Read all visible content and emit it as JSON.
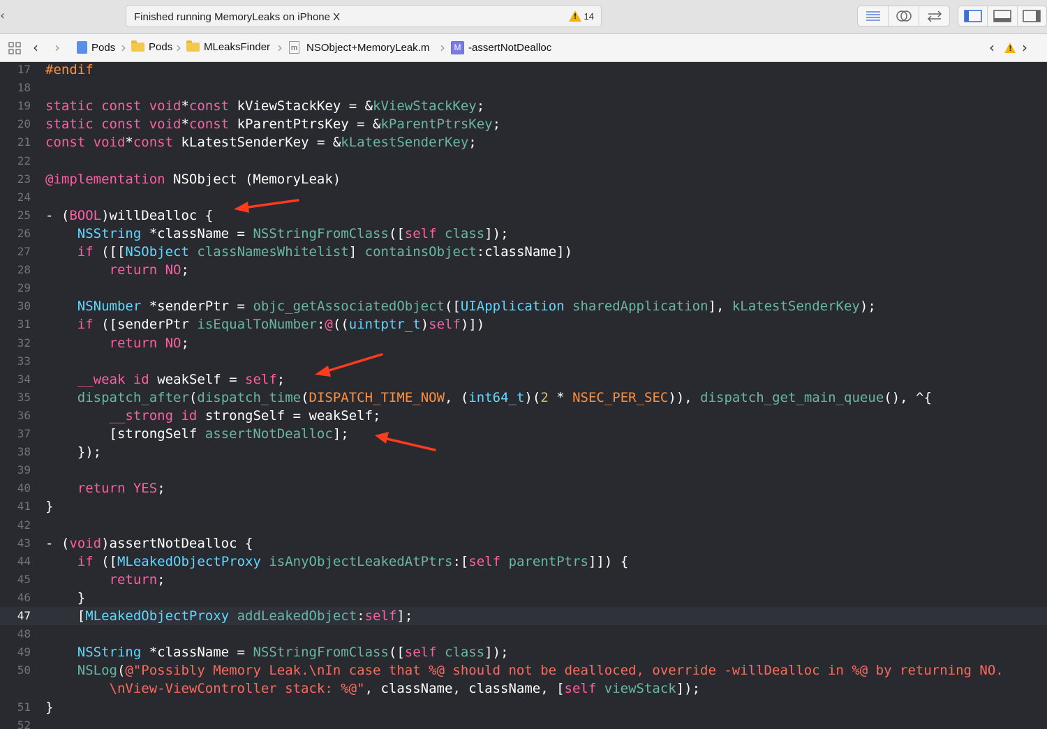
{
  "toolbar": {
    "status": "Finished running MemoryLeaks on iPhone X",
    "warning_count": "14",
    "editor_buttons": [
      "standard-editor-icon",
      "assistant-editor-icon",
      "version-editor-icon"
    ],
    "view_buttons": [
      "navigator-toggle-icon",
      "debug-area-toggle-icon",
      "utilities-toggle-icon"
    ]
  },
  "jumpbar": {
    "crumbs": [
      "Pods",
      "Pods",
      "MLeaksFinder",
      "NSObject+MemoryLeak.m",
      "-assertNotDealloc"
    ],
    "method_icon": "M",
    "file_icon": "m"
  },
  "editor": {
    "current_line": 47,
    "lines": [
      {
        "n": "17",
        "t": [
          [
            "pre",
            "#endif"
          ]
        ]
      },
      {
        "n": "18",
        "t": []
      },
      {
        "n": "19",
        "t": [
          [
            "kw",
            "static const void"
          ],
          [
            "",
            "*"
          ],
          [
            "kw",
            "const"
          ],
          [
            "",
            " kViewStackKey = &"
          ],
          [
            "fn",
            "kViewStackKey"
          ],
          [
            "",
            ";"
          ]
        ]
      },
      {
        "n": "20",
        "t": [
          [
            "kw",
            "static const void"
          ],
          [
            "",
            "*"
          ],
          [
            "kw",
            "const"
          ],
          [
            "",
            " kParentPtrsKey = &"
          ],
          [
            "fn",
            "kParentPtrsKey"
          ],
          [
            "",
            ";"
          ]
        ]
      },
      {
        "n": "21",
        "t": [
          [
            "kw",
            "const void"
          ],
          [
            "",
            "*"
          ],
          [
            "kw",
            "const"
          ],
          [
            "",
            " kLatestSenderKey = &"
          ],
          [
            "fn",
            "kLatestSenderKey"
          ],
          [
            "",
            ";"
          ]
        ]
      },
      {
        "n": "22",
        "t": []
      },
      {
        "n": "23",
        "t": [
          [
            "kw",
            "@implementation"
          ],
          [
            "",
            " NSObject (MemoryLeak)"
          ]
        ]
      },
      {
        "n": "24",
        "t": []
      },
      {
        "n": "25",
        "t": [
          [
            "",
            "- ("
          ],
          [
            "kw",
            "BOOL"
          ],
          [
            "",
            ")willDealloc {"
          ]
        ]
      },
      {
        "n": "26",
        "t": [
          [
            "",
            "    "
          ],
          [
            "ty",
            "NSString"
          ],
          [
            "",
            " *className = "
          ],
          [
            "fn",
            "NSStringFromClass"
          ],
          [
            "",
            "(["
          ],
          [
            "kw",
            "self"
          ],
          [
            "",
            " "
          ],
          [
            "fn",
            "class"
          ],
          [
            "",
            "]);"
          ]
        ]
      },
      {
        "n": "27",
        "t": [
          [
            "",
            "    "
          ],
          [
            "kw",
            "if"
          ],
          [
            "",
            " ([["
          ],
          [
            "ty",
            "NSObject"
          ],
          [
            "",
            " "
          ],
          [
            "fn",
            "classNamesWhitelist"
          ],
          [
            "",
            "] "
          ],
          [
            "fn",
            "containsObject"
          ],
          [
            "",
            ":className])"
          ]
        ]
      },
      {
        "n": "28",
        "t": [
          [
            "",
            "        "
          ],
          [
            "kw",
            "return"
          ],
          [
            "",
            " "
          ],
          [
            "kw",
            "NO"
          ],
          [
            "",
            ";"
          ]
        ]
      },
      {
        "n": "29",
        "t": []
      },
      {
        "n": "30",
        "t": [
          [
            "",
            "    "
          ],
          [
            "ty",
            "NSNumber"
          ],
          [
            "",
            " *senderPtr = "
          ],
          [
            "fn",
            "objc_getAssociatedObject"
          ],
          [
            "",
            "(["
          ],
          [
            "ty",
            "UIApplication"
          ],
          [
            "",
            " "
          ],
          [
            "fn",
            "sharedApplication"
          ],
          [
            "",
            "], "
          ],
          [
            "fn",
            "kLatestSenderKey"
          ],
          [
            "",
            ");"
          ]
        ]
      },
      {
        "n": "31",
        "t": [
          [
            "",
            "    "
          ],
          [
            "kw",
            "if"
          ],
          [
            "",
            " ([senderPtr "
          ],
          [
            "fn",
            "isEqualToNumber"
          ],
          [
            "",
            ":"
          ],
          [
            "kw",
            "@"
          ],
          [
            "",
            "(("
          ],
          [
            "ty",
            "uintptr_t"
          ],
          [
            "",
            ")"
          ],
          [
            "kw",
            "self"
          ],
          [
            "",
            ")])"
          ]
        ]
      },
      {
        "n": "32",
        "t": [
          [
            "",
            "        "
          ],
          [
            "kw",
            "return"
          ],
          [
            "",
            " "
          ],
          [
            "kw",
            "NO"
          ],
          [
            "",
            ";"
          ]
        ]
      },
      {
        "n": "33",
        "t": []
      },
      {
        "n": "34",
        "t": [
          [
            "",
            "    "
          ],
          [
            "kw",
            "__weak"
          ],
          [
            "",
            " "
          ],
          [
            "kw",
            "id"
          ],
          [
            "",
            " weakSelf = "
          ],
          [
            "kw",
            "self"
          ],
          [
            "",
            ";"
          ]
        ]
      },
      {
        "n": "35",
        "t": [
          [
            "",
            "    "
          ],
          [
            "fn",
            "dispatch_after"
          ],
          [
            "",
            "("
          ],
          [
            "fn",
            "dispatch_time"
          ],
          [
            "",
            "("
          ],
          [
            "mac",
            "DISPATCH_TIME_NOW"
          ],
          [
            "",
            ", ("
          ],
          [
            "ty",
            "int64_t"
          ],
          [
            "",
            ")("
          ],
          [
            "num",
            "2"
          ],
          [
            "",
            " * "
          ],
          [
            "mac",
            "NSEC_PER_SEC"
          ],
          [
            "",
            "))"
          ],
          [
            "",
            ", "
          ],
          [
            "fn",
            "dispatch_get_main_queue"
          ],
          [
            "",
            "(), ^{"
          ]
        ]
      },
      {
        "n": "36",
        "t": [
          [
            "",
            "        "
          ],
          [
            "kw",
            "__strong"
          ],
          [
            "",
            " "
          ],
          [
            "kw",
            "id"
          ],
          [
            "",
            " strongSelf = weakSelf;"
          ]
        ]
      },
      {
        "n": "37",
        "t": [
          [
            "",
            "        [strongSelf "
          ],
          [
            "fn",
            "assertNotDealloc"
          ],
          [
            "",
            "];"
          ]
        ]
      },
      {
        "n": "38",
        "t": [
          [
            "",
            "    });"
          ]
        ]
      },
      {
        "n": "39",
        "t": []
      },
      {
        "n": "40",
        "t": [
          [
            "",
            "    "
          ],
          [
            "kw",
            "return"
          ],
          [
            "",
            " "
          ],
          [
            "kw",
            "YES"
          ],
          [
            "",
            ";"
          ]
        ]
      },
      {
        "n": "41",
        "t": [
          [
            "",
            "}"
          ]
        ]
      },
      {
        "n": "42",
        "t": []
      },
      {
        "n": "43",
        "t": [
          [
            "",
            "- ("
          ],
          [
            "kw",
            "void"
          ],
          [
            "",
            ")assertNotDealloc {"
          ]
        ]
      },
      {
        "n": "44",
        "t": [
          [
            "",
            "    "
          ],
          [
            "kw",
            "if"
          ],
          [
            "",
            " (["
          ],
          [
            "ty",
            "MLeakedObjectProxy"
          ],
          [
            "",
            " "
          ],
          [
            "fn",
            "isAnyObjectLeakedAtPtrs"
          ],
          [
            "",
            ":["
          ],
          [
            "kw",
            "self"
          ],
          [
            "",
            " "
          ],
          [
            "fn",
            "parentPtrs"
          ],
          [
            "",
            "]]) {"
          ]
        ]
      },
      {
        "n": "45",
        "t": [
          [
            "",
            "        "
          ],
          [
            "kw",
            "return"
          ],
          [
            "",
            ";"
          ]
        ]
      },
      {
        "n": "46",
        "t": [
          [
            "",
            "    }"
          ]
        ]
      },
      {
        "n": "47",
        "t": [
          [
            "",
            "    ["
          ],
          [
            "ty",
            "MLeakedObjectProxy"
          ],
          [
            "",
            " "
          ],
          [
            "fn",
            "addLeakedObject"
          ],
          [
            "",
            ":"
          ],
          [
            "kw",
            "self"
          ],
          [
            "",
            "];"
          ]
        ]
      },
      {
        "n": "48",
        "t": []
      },
      {
        "n": "49",
        "t": [
          [
            "",
            "    "
          ],
          [
            "ty",
            "NSString"
          ],
          [
            "",
            " *className = "
          ],
          [
            "fn",
            "NSStringFromClass"
          ],
          [
            "",
            "(["
          ],
          [
            "kw",
            "self"
          ],
          [
            "",
            " "
          ],
          [
            "fn",
            "class"
          ],
          [
            "",
            "]);"
          ]
        ]
      },
      {
        "n": "50",
        "t": [
          [
            "",
            "    "
          ],
          [
            "fn",
            "NSLog"
          ],
          [
            "",
            "("
          ],
          [
            "str",
            "@\"Possibly Memory Leak.\\nIn case that %@ should not be dealloced, override -willDealloc in %@ by returning NO."
          ]
        ]
      },
      {
        "n": "",
        "t": [
          [
            "str",
            "        \\nView-ViewController stack: %@\""
          ],
          [
            "",
            ", className, className, ["
          ],
          [
            "kw",
            "self"
          ],
          [
            "",
            " "
          ],
          [
            "fn",
            "viewStack"
          ],
          [
            "",
            "]);"
          ]
        ]
      },
      {
        "n": "51",
        "t": [
          [
            "",
            "}"
          ]
        ]
      },
      {
        "n": "52",
        "t": []
      }
    ]
  },
  "colors": {
    "background": "#292a30",
    "keyword": "#fc5fa3",
    "type": "#5dd8ff",
    "function": "#67b7a4",
    "string": "#fc6a5d",
    "preprocessor": "#fd8f3f",
    "annotation_arrow": "#ff3b1f"
  }
}
